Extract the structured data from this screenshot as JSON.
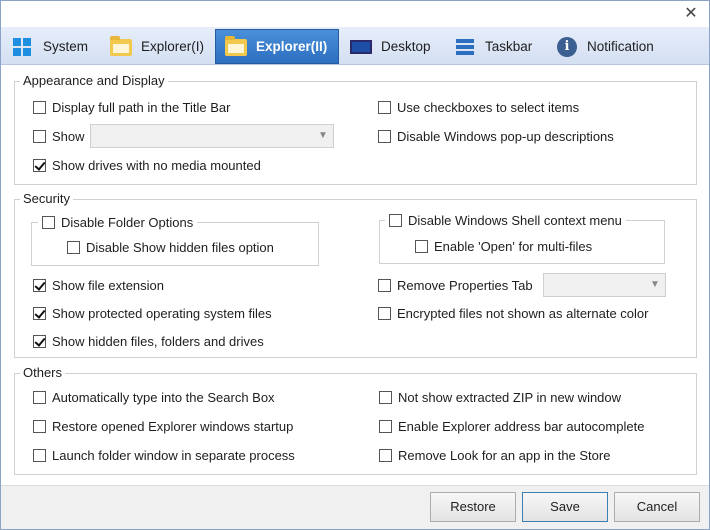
{
  "window": {
    "close_glyph": "✕"
  },
  "tabs": [
    {
      "label": "System",
      "icon": "windows-logo-icon"
    },
    {
      "label": "Explorer(I)",
      "icon": "folder-icon"
    },
    {
      "label": "Explorer(II)",
      "icon": "folder-icon",
      "active": true
    },
    {
      "label": "Desktop",
      "icon": "desktop-icon"
    },
    {
      "label": "Taskbar",
      "icon": "taskbar-icon"
    },
    {
      "label": "Notification",
      "icon": "info-icon"
    }
  ],
  "appearance": {
    "title": "Appearance and Display",
    "display_full_path": {
      "label": "Display full path in the Title Bar",
      "checked": false
    },
    "show": {
      "label": "Show",
      "checked": false,
      "combo_value": ""
    },
    "show_drives": {
      "label": "Show drives with no media mounted",
      "checked": true
    },
    "use_checkboxes": {
      "label": "Use checkboxes to select items",
      "checked": false
    },
    "disable_popup": {
      "label": "Disable Windows pop-up descriptions",
      "checked": false
    }
  },
  "security": {
    "title": "Security",
    "disable_folder_options": {
      "label": "Disable Folder Options",
      "checked": false
    },
    "disable_show_hidden": {
      "label": "Disable Show hidden files option",
      "checked": false
    },
    "disable_shell_menu": {
      "label": "Disable Windows Shell context menu",
      "checked": false
    },
    "enable_open_multi": {
      "label": "Enable 'Open' for multi-files",
      "checked": false
    },
    "show_file_extension": {
      "label": "Show file extension",
      "checked": true
    },
    "show_protected": {
      "label": "Show protected operating system files",
      "checked": true
    },
    "show_hidden": {
      "label": "Show hidden files, folders and drives",
      "checked": true
    },
    "remove_properties": {
      "label": "Remove Properties Tab",
      "checked": false,
      "combo_value": ""
    },
    "encrypted_color": {
      "label": "Encrypted files not shown as alternate color",
      "checked": false
    }
  },
  "others": {
    "title": "Others",
    "auto_type": {
      "label": "Automatically type into the Search Box",
      "checked": false
    },
    "restore_windows": {
      "label": "Restore opened Explorer windows startup",
      "checked": false
    },
    "separate_process": {
      "label": "Launch folder window in separate process",
      "checked": false
    },
    "no_zip_window": {
      "label": "Not show extracted ZIP in new window",
      "checked": false
    },
    "address_autocomplete": {
      "label": "Enable Explorer address bar autocomplete",
      "checked": false
    },
    "remove_store_lookup": {
      "label": "Remove Look for an app in the Store",
      "checked": false
    }
  },
  "footer": {
    "restore": "Restore",
    "save": "Save",
    "cancel": "Cancel"
  },
  "colors": {
    "active_tab": "#2c6fc0",
    "tabbar": "#dbe5f5",
    "group_border": "#d0d0d0"
  }
}
